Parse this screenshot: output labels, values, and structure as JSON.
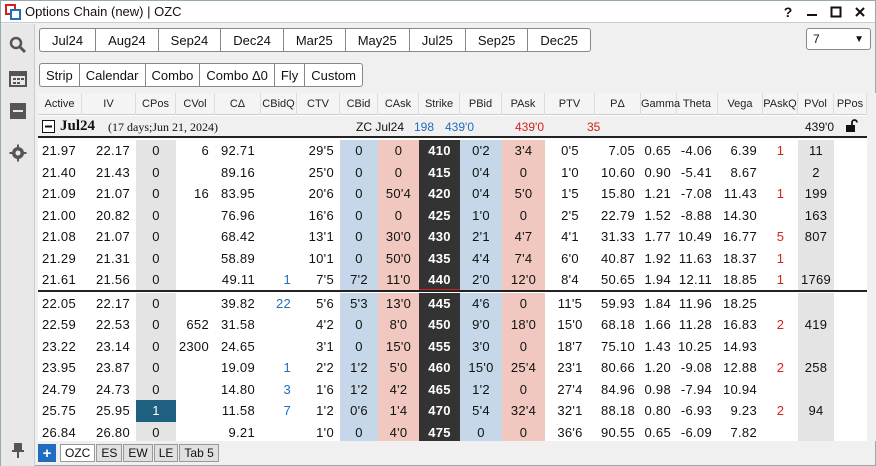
{
  "window": {
    "title": "Options Chain (new) | OZC"
  },
  "expirations": [
    "Jul24",
    "Aug24",
    "Sep24",
    "Dec24",
    "Mar25",
    "May25",
    "Jul25",
    "Sep25",
    "Dec25"
  ],
  "strike_count": "7",
  "strategies": [
    "Strip",
    "Calendar",
    "Combo",
    "Combo Δ0",
    "Fly",
    "Custom"
  ],
  "columns": [
    "Active",
    "IV",
    "CPos",
    "CVol",
    "CΔ",
    "CBidQ",
    "CTV",
    "CBid",
    "CAsk",
    "Strike",
    "PBid",
    "PAsk",
    "PTV",
    "PΔ",
    "Gamma",
    "Theta",
    "Vega",
    "PAskQ",
    "PVol",
    "PPos"
  ],
  "group": {
    "name": "Jul24",
    "info": "(17 days;Jun 21, 2024)",
    "underlying": "ZC Jul24",
    "bid": "198",
    "last": "439'0",
    "ask": "439'0",
    "change": "35",
    "pvol_value": "439'0"
  },
  "rows": [
    {
      "active": "21.97",
      "iv": "22.17",
      "cpos": "0",
      "cvol": "6",
      "cdelta": "92.71",
      "cbidq": "",
      "ctv": "29'5",
      "cbid": "0",
      "cask": "0",
      "strike": "410",
      "pbid": "0'2",
      "pask": "3'4",
      "ptv": "0'5",
      "pdelta": "7.05",
      "gamma": "0.65",
      "theta": "-4.06",
      "vega": "6.39",
      "paskq": "1",
      "pvol": "11",
      "ppos": ""
    },
    {
      "active": "21.40",
      "iv": "21.43",
      "cpos": "0",
      "cvol": "",
      "cdelta": "89.16",
      "cbidq": "",
      "ctv": "25'0",
      "cbid": "0",
      "cask": "0",
      "strike": "415",
      "pbid": "0'4",
      "pask": "0",
      "ptv": "1'0",
      "pdelta": "10.60",
      "gamma": "0.90",
      "theta": "-5.41",
      "vega": "8.67",
      "paskq": "",
      "pvol": "2",
      "ppos": ""
    },
    {
      "active": "21.09",
      "iv": "21.07",
      "cpos": "0",
      "cvol": "16",
      "cdelta": "83.95",
      "cbidq": "",
      "ctv": "20'6",
      "cbid": "0",
      "cask": "50'4",
      "strike": "420",
      "pbid": "0'4",
      "pask": "5'0",
      "ptv": "1'5",
      "pdelta": "15.80",
      "gamma": "1.21",
      "theta": "-7.08",
      "vega": "11.43",
      "paskq": "1",
      "pvol": "199",
      "ppos": ""
    },
    {
      "active": "21.00",
      "iv": "20.82",
      "cpos": "0",
      "cvol": "",
      "cdelta": "76.96",
      "cbidq": "",
      "ctv": "16'6",
      "cbid": "0",
      "cask": "0",
      "strike": "425",
      "pbid": "1'0",
      "pask": "0",
      "ptv": "2'5",
      "pdelta": "22.79",
      "gamma": "1.52",
      "theta": "-8.88",
      "vega": "14.30",
      "paskq": "",
      "pvol": "163",
      "ppos": ""
    },
    {
      "active": "21.08",
      "iv": "21.07",
      "cpos": "0",
      "cvol": "",
      "cdelta": "68.42",
      "cbidq": "",
      "ctv": "13'1",
      "cbid": "0",
      "cask": "30'0",
      "strike": "430",
      "pbid": "2'1",
      "pask": "4'7",
      "ptv": "4'1",
      "pdelta": "31.33",
      "gamma": "1.77",
      "theta": "10.49",
      "vega": "16.77",
      "paskq": "5",
      "pvol": "807",
      "ppos": ""
    },
    {
      "active": "21.29",
      "iv": "21.31",
      "cpos": "0",
      "cvol": "",
      "cdelta": "58.89",
      "cbidq": "",
      "ctv": "10'1",
      "cbid": "0",
      "cask": "50'0",
      "strike": "435",
      "pbid": "4'4",
      "pask": "7'4",
      "ptv": "6'0",
      "pdelta": "40.87",
      "gamma": "1.92",
      "theta": "11.63",
      "vega": "18.37",
      "paskq": "1",
      "pvol": "",
      "ppos": ""
    },
    {
      "active": "21.61",
      "iv": "21.56",
      "cpos": "0",
      "cvol": "",
      "cdelta": "49.11",
      "cbidq": "1",
      "ctv": "7'5",
      "cbid": "7'2",
      "cask": "11'0",
      "strike": "440",
      "pbid": "2'0",
      "pask": "12'0",
      "ptv": "8'4",
      "pdelta": "50.65",
      "gamma": "1.94",
      "theta": "12.11",
      "vega": "18.85",
      "paskq": "1",
      "pvol": "1769",
      "ppos": ""
    },
    {
      "active": "22.05",
      "iv": "22.17",
      "cpos": "0",
      "cvol": "",
      "cdelta": "39.82",
      "cbidq": "22",
      "ctv": "5'6",
      "cbid": "5'3",
      "cask": "13'0",
      "strike": "445",
      "pbid": "4'6",
      "pask": "0",
      "ptv": "11'5",
      "pdelta": "59.93",
      "gamma": "1.84",
      "theta": "11.96",
      "vega": "18.25",
      "paskq": "",
      "pvol": "",
      "ppos": ""
    },
    {
      "active": "22.59",
      "iv": "22.53",
      "cpos": "0",
      "cvol": "652",
      "cdelta": "31.58",
      "cbidq": "",
      "ctv": "4'2",
      "cbid": "0",
      "cask": "8'0",
      "strike": "450",
      "pbid": "9'0",
      "pask": "18'0",
      "ptv": "15'0",
      "pdelta": "68.18",
      "gamma": "1.66",
      "theta": "11.28",
      "vega": "16.83",
      "paskq": "2",
      "pvol": "419",
      "ppos": ""
    },
    {
      "active": "23.22",
      "iv": "23.14",
      "cpos": "0",
      "cvol": "2300",
      "cdelta": "24.65",
      "cbidq": "",
      "ctv": "3'1",
      "cbid": "0",
      "cask": "15'0",
      "strike": "455",
      "pbid": "3'0",
      "pask": "0",
      "ptv": "18'7",
      "pdelta": "75.10",
      "gamma": "1.43",
      "theta": "10.25",
      "vega": "14.93",
      "paskq": "",
      "pvol": "",
      "ppos": ""
    },
    {
      "active": "23.95",
      "iv": "23.87",
      "cpos": "0",
      "cvol": "",
      "cdelta": "19.09",
      "cbidq": "1",
      "ctv": "2'2",
      "cbid": "1'2",
      "cask": "5'0",
      "strike": "460",
      "pbid": "15'0",
      "pask": "25'4",
      "ptv": "23'1",
      "pdelta": "80.66",
      "gamma": "1.20",
      "theta": "-9.08",
      "vega": "12.88",
      "paskq": "2",
      "pvol": "258",
      "ppos": ""
    },
    {
      "active": "24.79",
      "iv": "24.73",
      "cpos": "0",
      "cvol": "",
      "cdelta": "14.80",
      "cbidq": "3",
      "ctv": "1'6",
      "cbid": "1'2",
      "cask": "4'2",
      "strike": "465",
      "pbid": "1'2",
      "pask": "0",
      "ptv": "27'4",
      "pdelta": "84.96",
      "gamma": "0.98",
      "theta": "-7.94",
      "vega": "10.94",
      "paskq": "",
      "pvol": "",
      "ppos": ""
    },
    {
      "active": "25.75",
      "iv": "25.95",
      "cpos": "1",
      "cvol": "",
      "cdelta": "11.58",
      "cbidq": "7",
      "ctv": "1'2",
      "cbid": "0'6",
      "cask": "1'4",
      "strike": "470",
      "pbid": "5'4",
      "pask": "32'4",
      "ptv": "32'1",
      "pdelta": "88.18",
      "gamma": "0.80",
      "theta": "-6.93",
      "vega": "9.23",
      "paskq": "2",
      "pvol": "94",
      "ppos": ""
    },
    {
      "active": "26.84",
      "iv": "26.80",
      "cpos": "0",
      "cvol": "",
      "cdelta": "9.21",
      "cbidq": "",
      "ctv": "1'0",
      "cbid": "0",
      "cask": "4'0",
      "strike": "475",
      "pbid": "0",
      "pask": "0",
      "ptv": "36'6",
      "pdelta": "90.55",
      "gamma": "0.65",
      "theta": "-6.09",
      "vega": "7.82",
      "paskq": "",
      "pvol": "",
      "ppos": ""
    }
  ],
  "tabs": [
    "OZC",
    "ES",
    "EW",
    "LE",
    "Tab 5"
  ],
  "colors": {
    "strike_bg": "#333333",
    "cpos_highlight": "#1f5f80",
    "bid_bg": "#c5d7e9",
    "ask_bg": "#f1c8c0",
    "atm_line": "#d3221a"
  }
}
